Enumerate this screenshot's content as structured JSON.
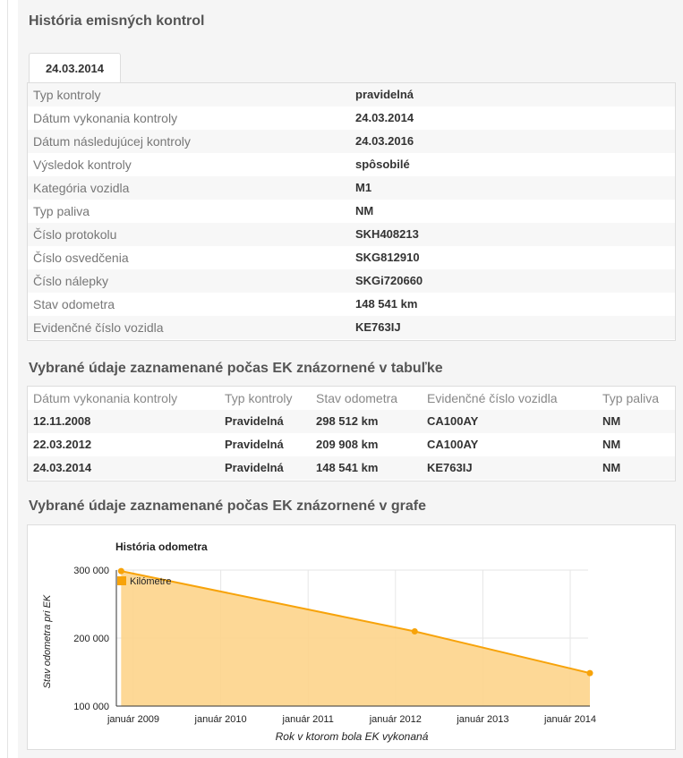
{
  "history": {
    "title": "História emisných kontrol",
    "tab_label": "24.03.2014",
    "rows": [
      {
        "label": "Typ kontroly",
        "value": "pravidelná"
      },
      {
        "label": "Dátum vykonania kontroly",
        "value": "24.03.2014"
      },
      {
        "label": "Dátum následujúcej kontroly",
        "value": "24.03.2016"
      },
      {
        "label": "Výsledok kontroly",
        "value": "spôsobilé"
      },
      {
        "label": "Kategória vozidla",
        "value": "M1"
      },
      {
        "label": "Typ paliva",
        "value": "NM"
      },
      {
        "label": "Číslo protokolu",
        "value": "SKH408213"
      },
      {
        "label": "Číslo osvedčenia",
        "value": "SKG812910"
      },
      {
        "label": "Číslo nálepky",
        "value": "SKGi720660"
      },
      {
        "label": "Stav odometra",
        "value": "148 541 km"
      },
      {
        "label": "Evidenčné číslo vozidla",
        "value": "KE763IJ"
      }
    ]
  },
  "table_section": {
    "title": "Vybrané údaje zaznamenané počas EK znázornené v tabuľke",
    "columns": [
      "Dátum vykonania kontroly",
      "Typ kontroly",
      "Stav odometra",
      "Evidenčné číslo vozidla",
      "Typ paliva"
    ],
    "rows": [
      [
        "12.11.2008",
        "Pravidelná",
        "298 512 km",
        "CA100AY",
        "NM"
      ],
      [
        "22.03.2012",
        "Pravidelná",
        "209 908 km",
        "CA100AY",
        "NM"
      ],
      [
        "24.03.2014",
        "Pravidelná",
        "148 541 km",
        "KE763IJ",
        "NM"
      ]
    ]
  },
  "chart_section": {
    "title": "Vybrané údaje zaznamenané počas EK znázornené v grafe"
  },
  "chart_data": {
    "type": "area",
    "title": "História odometra",
    "xlabel": "Rok v ktorom bola EK vykonaná",
    "ylabel": "Stav odometra pri EK",
    "legend": "top-left",
    "grid": true,
    "ylim": [
      100000,
      300000
    ],
    "y_ticks": [
      {
        "value": 300000,
        "label": "300 000"
      },
      {
        "value": 200000,
        "label": "200 000"
      },
      {
        "value": 100000,
        "label": "100 000"
      }
    ],
    "x_ticks": [
      {
        "value": 2009.0,
        "label": "január 2009"
      },
      {
        "value": 2010.0,
        "label": "január 2010"
      },
      {
        "value": 2011.0,
        "label": "január 2011"
      },
      {
        "value": 2012.0,
        "label": "január 2012"
      },
      {
        "value": 2013.0,
        "label": "január 2013"
      },
      {
        "value": 2014.0,
        "label": "január 2014"
      }
    ],
    "xlim": [
      2009.0,
      2014.2
    ],
    "series": [
      {
        "name": "Kilómetre",
        "points": [
          {
            "x": 2008.86,
            "y": 298512
          },
          {
            "x": 2012.22,
            "y": 209908
          },
          {
            "x": 2014.23,
            "y": 148541
          }
        ]
      }
    ],
    "colors": {
      "line": "#f7a30a",
      "fill": "#fdd48b",
      "point": "#f7a30a"
    }
  }
}
